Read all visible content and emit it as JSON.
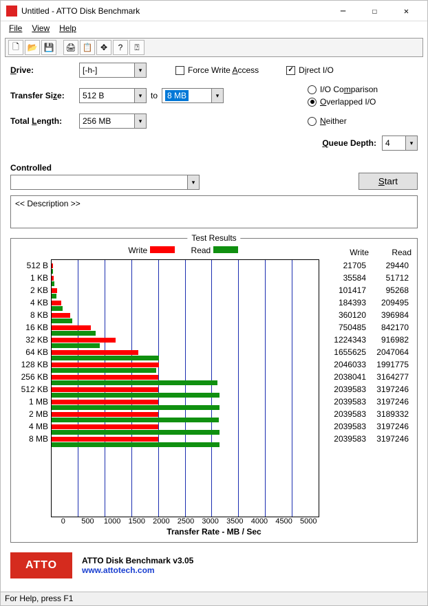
{
  "window": {
    "title": "Untitled - ATTO Disk Benchmark"
  },
  "menu": {
    "file": "File",
    "view": "View",
    "help": "Help"
  },
  "toolbar": {
    "new": "new-file-icon",
    "open": "open-icon",
    "save": "save-icon",
    "print": "print-icon",
    "copy": "copy-icon",
    "move": "move-icon",
    "help": "help-icon",
    "context_help": "context-help-icon"
  },
  "form": {
    "drive_label": "Drive:",
    "drive_value": "[-h-]",
    "transfer_label": "Transfer Size:",
    "transfer_from": "512 B",
    "transfer_to_label": "to",
    "transfer_to": "8 MB",
    "length_label": "Total Length:",
    "length_value": "256 MB",
    "force_write": "Force Write Access",
    "direct_io": "Direct I/O",
    "io_comparison": "I/O Comparison",
    "overlapped": "Overlapped I/O",
    "neither": "Neither",
    "queue_label": "Queue Depth:",
    "queue_value": "4",
    "controlled_label": "Controlled",
    "controlled_value": "",
    "start": "Start",
    "description": "<< Description >>"
  },
  "chart": {
    "frame_title": "Test Results",
    "legend_write": "Write",
    "legend_read": "Read",
    "col_write": "Write",
    "col_read": "Read",
    "xaxis_title": "Transfer Rate - MB / Sec"
  },
  "chart_data": {
    "type": "bar",
    "orientation": "horizontal",
    "categories": [
      "512 B",
      "1 KB",
      "2 KB",
      "4 KB",
      "8 KB",
      "16 KB",
      "32 KB",
      "64 KB",
      "128 KB",
      "256 KB",
      "512 KB",
      "1 MB",
      "2 MB",
      "4 MB",
      "8 MB"
    ],
    "series": [
      {
        "name": "Write",
        "color": "#ff0000",
        "units": "KB/s",
        "values": [
          21705,
          35584,
          101417,
          184393,
          360120,
          750485,
          1224343,
          1655625,
          2046033,
          2038041,
          2039583,
          2039583,
          2039583,
          2039583,
          2039583
        ]
      },
      {
        "name": "Read",
        "color": "#109010",
        "units": "KB/s",
        "values": [
          29440,
          51712,
          95268,
          209495,
          396984,
          842170,
          916982,
          2047064,
          1991775,
          3164277,
          3197246,
          3197246,
          3189332,
          3197246,
          3197246
        ]
      }
    ],
    "xlabel": "Transfer Rate - MB / Sec",
    "xlim": [
      0,
      5000
    ],
    "xticks": [
      0,
      500,
      1000,
      1500,
      2000,
      2500,
      3000,
      3500,
      4000,
      4500,
      5000
    ],
    "ylabel": "",
    "title": "Test Results",
    "note": "bar lengths plotted in MB/s = value/1024; numeric columns display raw KB/s values"
  },
  "footer": {
    "product": "ATTO Disk Benchmark v3.05",
    "url": "www.attotech.com",
    "logo_text": "ATTO"
  },
  "status": {
    "text": "For Help, press F1"
  }
}
